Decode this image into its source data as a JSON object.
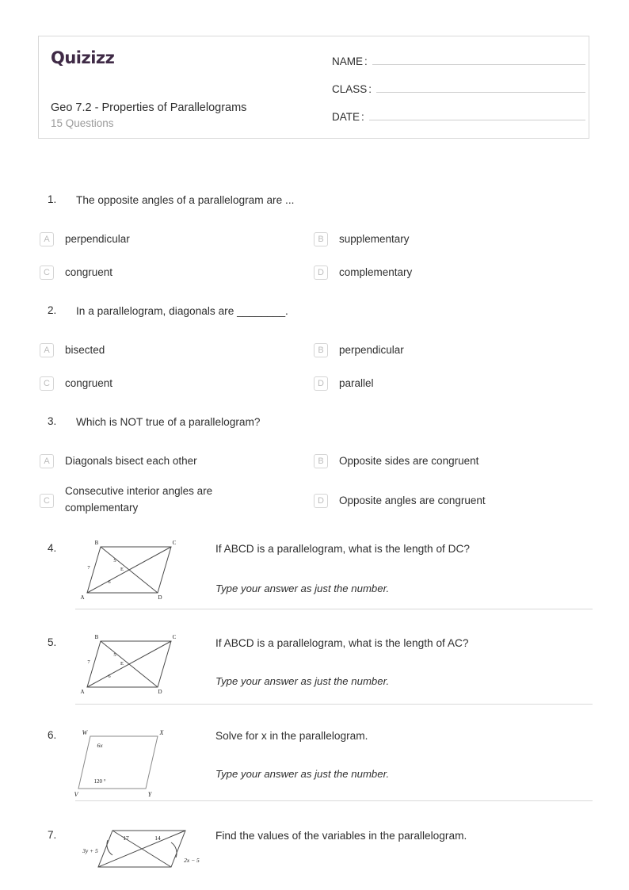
{
  "header": {
    "logo_text": "Quizizz",
    "logo_color": "#3f2a46",
    "title": "Geo 7.2 - Properties of Parallelograms",
    "subtitle": "15 Questions",
    "fields": [
      {
        "label": "NAME",
        "colon": ":",
        "value": ""
      },
      {
        "label": "CLASS",
        "colon": ":",
        "value": ""
      },
      {
        "label": "DATE",
        "colon": ":",
        "value": ""
      }
    ]
  },
  "questions": [
    {
      "number": "1.",
      "text": "The opposite angles of a parallelogram are ...",
      "options": [
        {
          "letter": "A",
          "text": "perpendicular"
        },
        {
          "letter": "B",
          "text": "supplementary"
        },
        {
          "letter": "C",
          "text": "congruent"
        },
        {
          "letter": "D",
          "text": "complementary"
        }
      ]
    },
    {
      "number": "2.",
      "text": "In a parallelogram, diagonals are ________.",
      "options": [
        {
          "letter": "A",
          "text": "bisected"
        },
        {
          "letter": "B",
          "text": "perpendicular"
        },
        {
          "letter": "C",
          "text": "congruent"
        },
        {
          "letter": "D",
          "text": "parallel"
        }
      ]
    },
    {
      "number": "3.",
      "text": "Which is NOT true of a parallelogram?",
      "options": [
        {
          "letter": "A",
          "text": "Diagonals bisect each other"
        },
        {
          "letter": "B",
          "text": "Opposite sides are congruent"
        },
        {
          "letter": "C",
          "text": "Consecutive interior angles are complementary"
        },
        {
          "letter": "D",
          "text": "Opposite angles are congruent"
        }
      ]
    },
    {
      "number": "4.",
      "text": "If ABCD is a parallelogram, what is the length of DC?",
      "hint": "Type your answer as just the number.",
      "figure": {
        "type": "parallelogram-abcd-diagonals",
        "vertex_labels": [
          "B",
          "C",
          "A",
          "D"
        ],
        "intersection_label": "E",
        "measure_labels": [
          "7",
          "5",
          "6"
        ]
      }
    },
    {
      "number": "5.",
      "text": "If ABCD is a parallelogram, what is the length of AC?",
      "hint": "Type your answer as just the number.",
      "figure": {
        "type": "parallelogram-abcd-diagonals",
        "vertex_labels": [
          "B",
          "C",
          "A",
          "D"
        ],
        "intersection_label": "E",
        "measure_labels": [
          "7",
          "5",
          "6"
        ]
      }
    },
    {
      "number": "6.",
      "text": "Solve for x in the parallelogram.",
      "hint": "Type your answer as just the number.",
      "figure": {
        "type": "parallelogram-wxyv",
        "vertex_labels": [
          "W",
          "X",
          "V",
          "Y"
        ],
        "angle_labels": [
          "6x",
          "120 °"
        ]
      }
    },
    {
      "number": "7.",
      "text": "Find the values of the variables in the parallelogram.",
      "figure": {
        "type": "parallelogram-diagonals-variables",
        "segment_labels": [
          "17",
          "14"
        ],
        "angle_labels": [
          "3y + 5",
          "2x − 5"
        ]
      }
    }
  ]
}
